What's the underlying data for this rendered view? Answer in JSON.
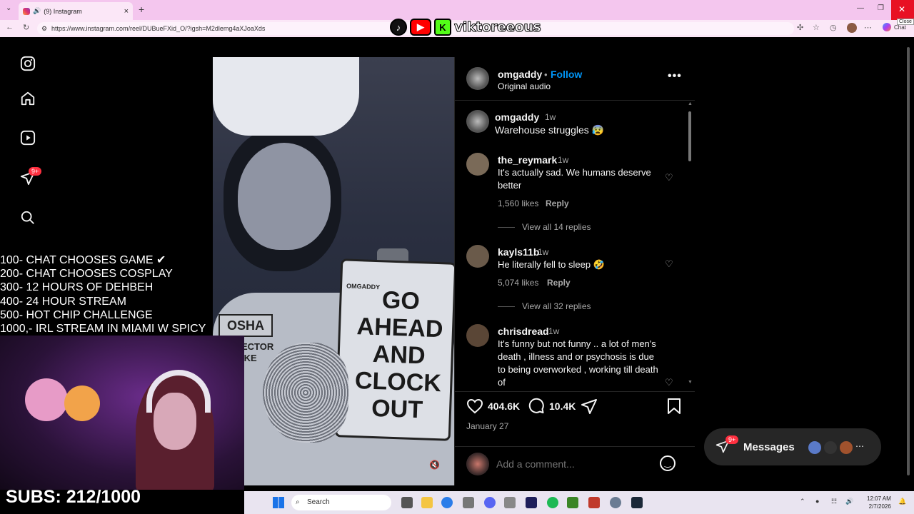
{
  "browser": {
    "tab_title": "(9) Instagram",
    "url": "https://www.instagram.com/reel/DUBueFXid_O/?igsh=M2dlemg4aXJoaXds",
    "close_tooltip": "Close",
    "chat_label": "Chat"
  },
  "stream_logo": {
    "name": "viktoreeous"
  },
  "sidebar": {
    "notification_badge": "9+"
  },
  "reel": {
    "vest_badge": "OSHA",
    "vest_text": "ECTOR\nIKE",
    "sign_brand": "OMGADDY",
    "sign_text": "GO\nAHEAD\nAND\nCLOCK\nOUT"
  },
  "post": {
    "author": "omgaddy",
    "separator": "•",
    "follow_label": "Follow",
    "audio": "Original audio",
    "caption_author": "omgaddy",
    "caption_time": "1w",
    "caption": "Warehouse struggles 😰",
    "comments": [
      {
        "user": "the_reymark",
        "time": "1w",
        "text": "It's actually sad. We humans deserve better",
        "likes": "1,560 likes",
        "reply": "Reply",
        "view_replies": "View all 14 replies"
      },
      {
        "user": "kayls11b",
        "time": "1w",
        "text": "He literally fell to sleep 🤣",
        "likes": "5,074 likes",
        "reply": "Reply",
        "view_replies": "View all 32 replies"
      },
      {
        "user": "chrisdread",
        "time": "1w",
        "text": "It's funny but not funny .. a lot of men's death , illness and or psychosis is due to being overworked , working till death of"
      }
    ],
    "like_count": "404.6K",
    "comment_count": "10.4K",
    "date": "January 27",
    "add_comment_placeholder": "Add a comment..."
  },
  "messages": {
    "label": "Messages",
    "badge": "9+"
  },
  "stream_goals": [
    "100- CHAT CHOOSES GAME ✔",
    "200- CHAT CHOOSES COSPLAY",
    "300- 12 HOURS OF DEHBEH",
    "400- 24 HOUR STREAM",
    "500- HOT CHIP CHALLENGE",
    "1000,- IRL STREAM IN MIAMI W SPICY"
  ],
  "subs_counter": "SUBS: 212/1000",
  "taskbar": {
    "search_label": "Search",
    "time": "12:07 AM",
    "date": "2/7/2026"
  },
  "colors": {
    "follow_blue": "#0095f6",
    "badge_red": "#ff3040",
    "tab_pink": "#f4c6ee"
  }
}
